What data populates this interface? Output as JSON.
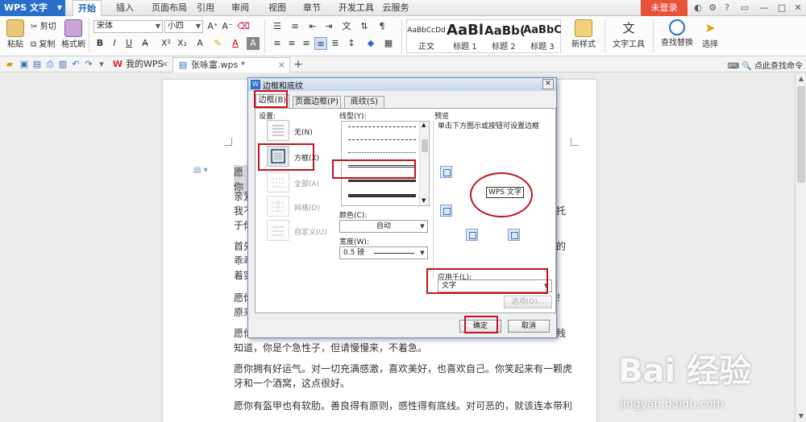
{
  "app": {
    "name": "WPS 文字",
    "tabs": [
      "开始",
      "插入",
      "页面布局",
      "引用",
      "审阅",
      "视图",
      "章节",
      "开发工具",
      "云服务"
    ],
    "active_tab": "开始",
    "login": "未登录"
  },
  "ribbon": {
    "paste": "粘贴",
    "cut": "剪切",
    "copy": "复制",
    "format_painter": "格式刷",
    "font_name": "宋体",
    "font_size": "小四",
    "styles": [
      {
        "sample": "AaBbCcDd",
        "name": "正文"
      },
      {
        "sample": "AaBl",
        "name": "标题 1"
      },
      {
        "sample": "AaBb(",
        "name": "标题 2"
      },
      {
        "sample": "AaBbC",
        "name": "标题 3"
      }
    ],
    "new_style": "新样式",
    "text_tools": "文字工具",
    "find_replace": "查找替换",
    "select": "选择"
  },
  "doc_tabs": [
    {
      "label": "我的WPS",
      "active": false
    },
    {
      "label": "张咏富.wps *",
      "active": true
    }
  ],
  "click_tip": "点此查找命令",
  "document": {
    "paragraphs": [
      "愿你",
      "亲爱",
      "我不",
      "于你",
      "首先",
      "乖乖",
      "着实",
      "愿你",
      "原来",
      "愿你",
      "知道，你是个急性子，但请慢慢来，不着急。",
      "愿你拥有好运气。对一切充满感激，喜欢美好，也喜欢自己。你笑起来有一颗虎",
      "牙和一个酒窝，这点很好。",
      "愿你有盔甲也有软肋。善良得有原则，感性得有底线。对可恶的，就该连本带利"
    ],
    "right_fragments": [
      "托",
      "的",
      "！",
      "残"
    ]
  },
  "dialog": {
    "title": "边框和底纹",
    "tabs": [
      "边框(B)",
      "页面边框(P)",
      "底纹(S)"
    ],
    "settings_label": "设置:",
    "settings": [
      {
        "label": "无(N)",
        "enabled": true
      },
      {
        "label": "方框(X)",
        "enabled": true
      },
      {
        "label": "全部(A)",
        "enabled": false
      },
      {
        "label": "网格(D)",
        "enabled": false
      },
      {
        "label": "自定义(U)",
        "enabled": false
      }
    ],
    "line_style_label": "线型(Y):",
    "color_label": "颜色(C):",
    "color_value": "自动",
    "width_label": "宽度(W):",
    "width_value": "0.5  磅",
    "preview_label": "预览",
    "preview_hint": "单击下方图示或按钮可设置边框",
    "preview_sample": "WPS 文字",
    "apply_label": "应用于(L):",
    "apply_value": "文字",
    "options_button": "选项(O)...",
    "ok_button": "确定",
    "cancel_button": "取消"
  },
  "watermark": {
    "brand": "Bai 经验",
    "url": "jingyan.baidu.com"
  },
  "colors": {
    "accent": "#2a6fc9",
    "login": "#e8523a",
    "annotation": "#c3141d"
  }
}
